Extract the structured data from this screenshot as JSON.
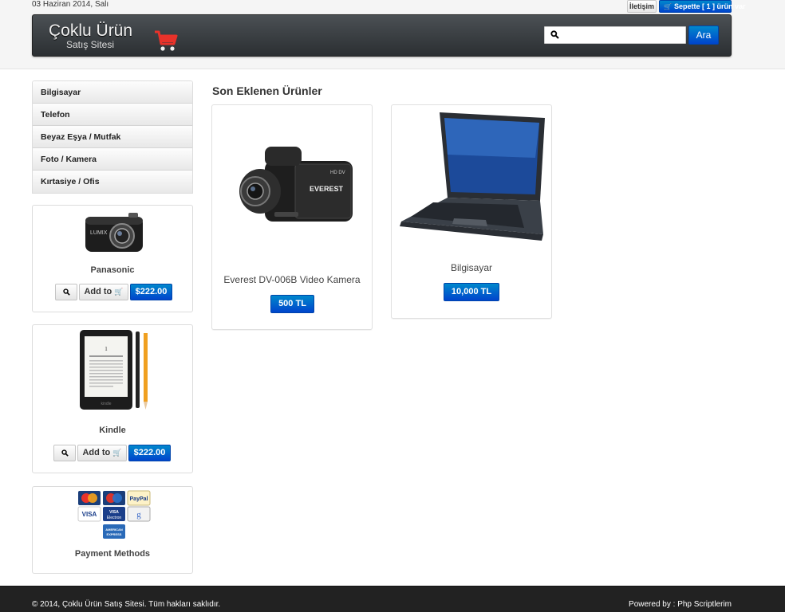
{
  "header": {
    "date": "03 Haziran 2014, Salı",
    "contact_label": "İletişim",
    "cart_label": "Sepette [ 1 ] ürün var",
    "logo_title": "Çoklu Ürün",
    "logo_subtitle": "Satış Sitesi",
    "search": {
      "placeholder": "",
      "value": "",
      "button_label": "Ara"
    }
  },
  "sidebar": {
    "categories": [
      {
        "label": "Bilgisayar"
      },
      {
        "label": "Telefon"
      },
      {
        "label": "Beyaz Eşya / Mutfak"
      },
      {
        "label": "Foto / Kamera"
      },
      {
        "label": "Kırtasiye / Ofis"
      }
    ],
    "featured": [
      {
        "name": "Panasonic",
        "add_label": "Add to",
        "price": "$222.00",
        "image_text": "LUMIX"
      },
      {
        "name": "Kindle",
        "add_label": "Add to",
        "price": "$222.00",
        "image_text": "kindle"
      }
    ],
    "payment": {
      "title": "Payment Methods",
      "cards": [
        "MasterCard",
        "Maestro",
        "PayPal",
        "VISA",
        "VISA Electron",
        "Google",
        "AMERICAN EXPRESS"
      ]
    }
  },
  "main": {
    "section_title": "Son Eklenen Ürünler",
    "products": [
      {
        "name": "Everest DV-006B Video Kamera",
        "price": "500 TL",
        "image_text": "EVEREST"
      },
      {
        "name": "Bilgisayar",
        "price": "10,000 TL"
      }
    ]
  },
  "footer": {
    "copyright": "© 2014, Çoklu Ürün Satış Sitesi. Tüm hakları saklıdır.",
    "powered": "Powered by : Php Scriptlerim"
  },
  "colors": {
    "primary": "#0055cc",
    "navbar": "#3a3e42",
    "footer": "#222222"
  }
}
